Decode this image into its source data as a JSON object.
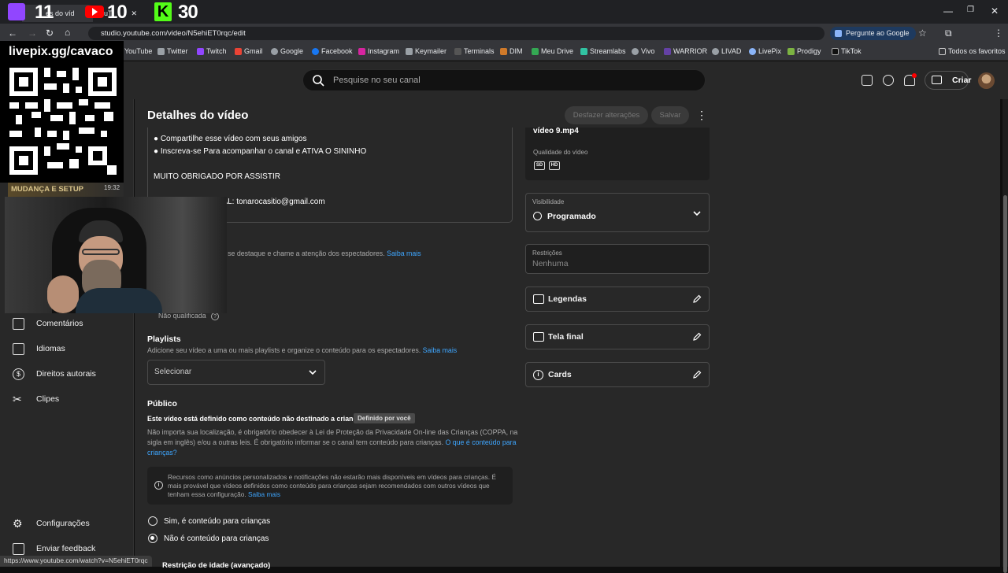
{
  "browser": {
    "tab_title": "es do víd",
    "tab2_title": "uT",
    "url": "studio.youtube.com/video/N5ehiET0rqc/edit",
    "google_button": "Pergunte ao Google",
    "bookmarks": [
      "YouTube",
      "Twitter",
      "Twitch",
      "Gmail",
      "Google",
      "Facebook",
      "Instagram",
      "Keymailer",
      "Terminals",
      "DIM",
      "Meu Drive",
      "Streamlabs",
      "Vivo",
      "WARRIOR",
      "LIVAD",
      "LivePix",
      "Prodigy",
      "TikTok"
    ],
    "favorites_label": "Todos os favoritos",
    "status_url": "https://www.youtube.com/watch?v=N5ehiET0rqc"
  },
  "overlay": {
    "counter_twitch": "11",
    "counter_youtube": "10",
    "counter_kick": "30",
    "livepix_url": "livepix.gg/cavaco",
    "thumb_text": "MUDANÇA E SETUP",
    "thumb_time": "19:32"
  },
  "header": {
    "search_placeholder": "Pesquise no seu canal",
    "create_label": "Criar"
  },
  "sidebar": {
    "items": [
      {
        "label": "Comentários",
        "icon": "comment-icon"
      },
      {
        "label": "Idiomas",
        "icon": "subtitles-icon"
      },
      {
        "label": "Direitos autorais",
        "icon": "copyright-icon"
      },
      {
        "label": "Clipes",
        "icon": "scissors-icon"
      }
    ],
    "settings_label": "Configurações",
    "feedback_label": "Enviar feedback"
  },
  "page": {
    "title": "Detalhes do vídeo",
    "undo_label": "Desfazer alterações",
    "save_label": "Salvar"
  },
  "description": {
    "line1": "● Compartilhe esse vídeo com seus amigos",
    "line2": "● Inscreva-se Para acompanhar o canal e  ATIVA O SININHO",
    "line3": "MUITO OBRIGADO POR ASSISTIR",
    "line4": "SIONAL: tonarocasitio@gmail.com"
  },
  "thumbnail": {
    "hint": "que se destaque e chame a atenção dos espectadores.",
    "hint_link": "Saiba mais",
    "status": "Não qualificada"
  },
  "playlists": {
    "heading": "Playlists",
    "desc": "Adicione seu vídeo a uma ou mais playlists e organize o conteúdo para os espectadores.",
    "link": "Saiba mais",
    "select": "Selecionar"
  },
  "audience": {
    "heading": "Público",
    "set_text": "Este vídeo está definido como conteúdo não destinado a crianças",
    "badge": "Definido por você",
    "law1": "Não importa sua localização, é obrigatório obedecer à Lei de Proteção da Privacidade On-line das Crianças (COPPA, na",
    "law2": "sigla em inglês) e/ou a outras leis. É obrigatório informar se o canal tem conteúdo para crianças.",
    "law_link1": "O que é conteúdo para",
    "law_link2": "crianças?",
    "info1": "Recursos como anúncios personalizados e notificações não estarão mais disponíveis em vídeos para crianças. É",
    "info2": "mais provável que vídeos definidos como conteúdo para crianças sejam recomendados com outros vídeos que",
    "info3": "tenham essa configuração.",
    "info_link": "Saiba mais",
    "option_yes": "Sim, é conteúdo para crianças",
    "option_no": "Não é conteúdo para crianças",
    "selected": "no",
    "next_section": "Restrição de idade (avançado)"
  },
  "right": {
    "filename": "vídeo 9.mp4",
    "quality_label": "Qualidade do vídeo",
    "quality_badges": [
      "SD",
      "HD"
    ],
    "visibility_label": "Visibilidade",
    "visibility_value": "Programado",
    "restrictions_label": "Restrições",
    "restrictions_value": "Nenhuma",
    "subtitles": "Legendas",
    "endscreen": "Tela final",
    "cards": "Cards"
  }
}
